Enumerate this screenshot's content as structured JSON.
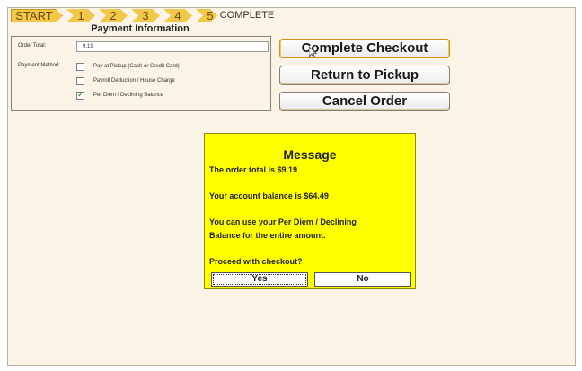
{
  "steps": [
    "START",
    "1",
    "2",
    "3",
    "4",
    "5",
    "COMPLETE"
  ],
  "payment": {
    "title": "Payment Information",
    "order_total_label": "Order Total:",
    "order_total_value": "9.19",
    "method_label": "Payment Method:",
    "options": [
      {
        "label": "Pay at Pickup (Cash or Credit Card)",
        "checked": false
      },
      {
        "label": "Payroll Deduction / House Charge",
        "checked": false
      },
      {
        "label": "Per Diem / Declining Balance",
        "checked": true
      }
    ]
  },
  "actions": {
    "complete": "Complete Checkout",
    "return": "Return to Pickup",
    "cancel": "Cancel Order"
  },
  "message": {
    "title": "Message",
    "line1": "The order total is $9.19",
    "line2": "Your account balance is $64.49",
    "line3": "You can use your Per Diem / Declining",
    "line4": "Balance for the entire amount.",
    "line5": "Proceed with checkout?",
    "yes": "Yes",
    "no": "No"
  }
}
